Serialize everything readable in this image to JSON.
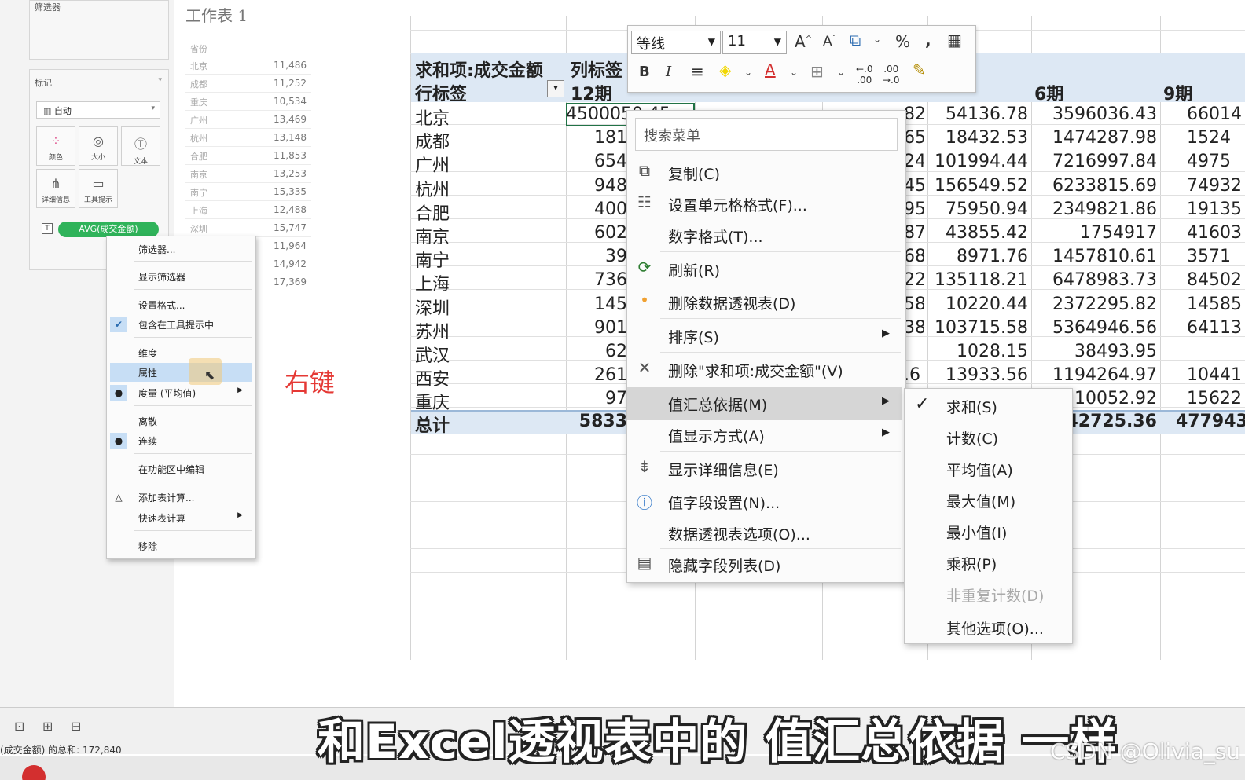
{
  "tableau": {
    "filters_label": "筛选器",
    "marks_label": "标记",
    "mark_type": "自动",
    "mark_buttons": [
      {
        "label": "颜色",
        "icon": "color-dots-icon"
      },
      {
        "label": "大小",
        "icon": "size-icon"
      },
      {
        "label": "文本",
        "icon": "text-icon"
      },
      {
        "label": "详细信息",
        "icon": "detail-icon"
      },
      {
        "label": "工具提示",
        "icon": "tooltip-icon"
      }
    ],
    "pill_label": "AVG(成交金额)",
    "sheet_title": "工作表 1",
    "table_header": "省份",
    "rows": [
      {
        "k": "北京",
        "v": "11,486"
      },
      {
        "k": "成都",
        "v": "11,252"
      },
      {
        "k": "重庆",
        "v": "10,534"
      },
      {
        "k": "广州",
        "v": "13,469"
      },
      {
        "k": "杭州",
        "v": "13,148"
      },
      {
        "k": "合肥",
        "v": "11,853"
      },
      {
        "k": "南京",
        "v": "13,253"
      },
      {
        "k": "南宁",
        "v": "15,335"
      },
      {
        "k": "上海",
        "v": "12,488"
      },
      {
        "k": "深圳",
        "v": "15,747"
      },
      {
        "k": "",
        "v": "11,964"
      },
      {
        "k": "",
        "v": "14,942"
      },
      {
        "k": "",
        "v": "17,369"
      }
    ],
    "context_menu": [
      "筛选器...",
      "显示筛选器",
      "设置格式...",
      "包含在工具提示中",
      "维度",
      "属性",
      "度量 (平均值)",
      "离散",
      "连续",
      "在功能区中编辑",
      "添加表计算...",
      "快速表计算",
      "移除"
    ],
    "status": "(成交金额) 的总和: 172,840"
  },
  "annotation": "右键",
  "excel": {
    "toolbar": {
      "font_name": "等线",
      "font_size": "11"
    },
    "pivot": {
      "value_label": "求和项:成交金额",
      "col_label": "列标签",
      "row_label": "行标签",
      "col_headers": [
        "12期",
        "6期",
        "9期"
      ],
      "rows": [
        {
          "city": "北京",
          "c1": "4500050.45",
          "c2": "54136.78",
          "c3": "3596036.43",
          "c4": "66014",
          "p": "82"
        },
        {
          "city": "成都",
          "c1": "181",
          "c2": "18432.53",
          "c3": "1474287.98",
          "c4": "1524",
          "p": "65"
        },
        {
          "city": "广州",
          "c1": "654",
          "c2": "101994.44",
          "c3": "7216997.84",
          "c4": "4975",
          "p": "24"
        },
        {
          "city": "杭州",
          "c1": "948",
          "c2": "156549.52",
          "c3": "6233815.69",
          "c4": "74932",
          "p": "45"
        },
        {
          "city": "合肥",
          "c1": "400",
          "c2": "75950.94",
          "c3": "2349821.86",
          "c4": "19135",
          "p": "95"
        },
        {
          "city": "南京",
          "c1": "602",
          "c2": "43855.42",
          "c3": "1754917",
          "c4": "41603",
          "p": "87"
        },
        {
          "city": "南宁",
          "c1": "39",
          "c2": "8971.76",
          "c3": "1457810.61",
          "c4": "3571",
          "p": "68"
        },
        {
          "city": "上海",
          "c1": "736",
          "c2": "135118.21",
          "c3": "6478983.73",
          "c4": "84502",
          "p": "22"
        },
        {
          "city": "深圳",
          "c1": "145",
          "c2": "10220.44",
          "c3": "2372295.82",
          "c4": "14585",
          "p": "58"
        },
        {
          "city": "苏州",
          "c1": "901",
          "c2": "103715.58",
          "c3": "5364946.56",
          "c4": "64113",
          "p": "38"
        },
        {
          "city": "武汉",
          "c1": "62",
          "c2": "1028.15",
          "c3": "38493.95",
          "c4": "",
          "p": ""
        },
        {
          "city": "西安",
          "c1": "261",
          "c2": "13933.56",
          "c3": "1194264.97",
          "c4": "10441",
          "p": ".6"
        },
        {
          "city": "重庆",
          "c1": "97",
          "c2": "",
          "c3": "110052.92",
          "c4": "15622",
          "p": ""
        }
      ],
      "total_label": "总计",
      "total_c1": "5833",
      "total_c3": "642725.36",
      "total_c4": "477943"
    },
    "context_menu": {
      "search_placeholder": "搜索菜单",
      "items": [
        "复制(C)",
        "设置单元格格式(F)...",
        "数字格式(T)...",
        "刷新(R)",
        "删除数据透视表(D)",
        "排序(S)",
        "删除\"求和项:成交金额\"(V)",
        "值汇总依据(M)",
        "值显示方式(A)",
        "显示详细信息(E)",
        "值字段设置(N)...",
        "数据透视表选项(O)...",
        "隐藏字段列表(D)"
      ]
    },
    "submenu": [
      "求和(S)",
      "计数(C)",
      "平均值(A)",
      "最大值(M)",
      "最小值(I)",
      "乘积(P)",
      "非重复计数(D)",
      "其他选项(O)..."
    ]
  },
  "subtitle": "和Excel透视表中的 值汇总依据 一样",
  "watermark": "CSDN @Olivia_su"
}
